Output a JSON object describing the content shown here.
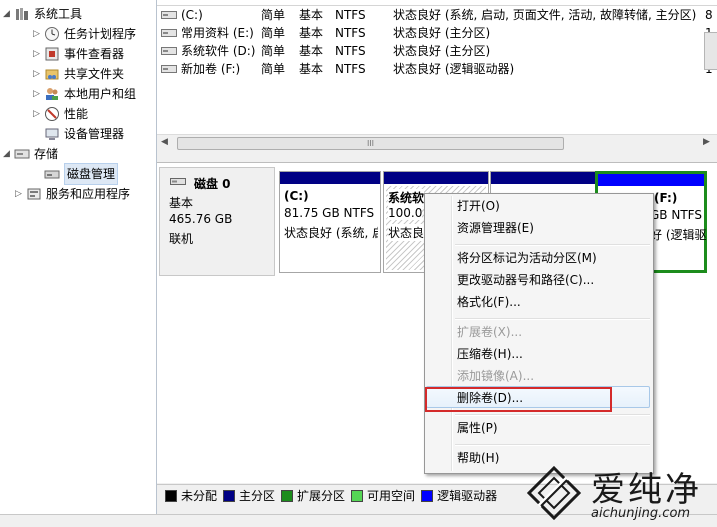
{
  "colors": {
    "primary_partition": "#000084",
    "logical_drive": "#0000ff",
    "extended_partition": "#1c8c1c",
    "free_space": "#55d655",
    "unallocated": "#000000",
    "highlight_box": "#d42a2a"
  },
  "tree": {
    "items": [
      {
        "label": "系统工具",
        "icon": "toolbox-icon",
        "expander": "expanded"
      },
      {
        "label": "任务计划程序",
        "icon": "clock-icon",
        "expander": "collapsed"
      },
      {
        "label": "事件查看器",
        "icon": "event-viewer-icon",
        "expander": "collapsed"
      },
      {
        "label": "共享文件夹",
        "icon": "shared-folder-icon",
        "expander": "collapsed"
      },
      {
        "label": "本地用户和组",
        "icon": "users-icon",
        "expander": "collapsed"
      },
      {
        "label": "性能",
        "icon": "performance-icon",
        "expander": "collapsed"
      },
      {
        "label": "设备管理器",
        "icon": "device-manager-icon",
        "expander": "none"
      },
      {
        "label": "存储",
        "icon": "storage-icon",
        "expander": "expanded"
      },
      {
        "label": "磁盘管理",
        "icon": "disk-icon",
        "expander": "none",
        "selected": true
      },
      {
        "label": "服务和应用程序",
        "icon": "services-icon",
        "expander": "collapsed"
      }
    ]
  },
  "volumes": {
    "rows": [
      {
        "name": "(C:)",
        "layout": "简单",
        "type": "基本",
        "fs": "NTFS",
        "status": "状态良好 (系统, 启动, 页面文件, 活动, 故障转储, 主分区)",
        "tail": "8"
      },
      {
        "name": "常用资料 (E:)",
        "layout": "简单",
        "type": "基本",
        "fs": "NTFS",
        "status": "状态良好 (主分区)",
        "tail": "1"
      },
      {
        "name": "系统软件 (D:)",
        "layout": "简单",
        "type": "基本",
        "fs": "NTFS",
        "status": "状态良好 (主分区)",
        "tail": "1"
      },
      {
        "name": "新加卷 (F:)",
        "layout": "简单",
        "type": "基本",
        "fs": "NTFS",
        "status": "状态良好 (逻辑驱动器)",
        "tail": "1"
      }
    ]
  },
  "scrollbar": {
    "thumb_grip": "III",
    "left_arrow": "◀",
    "right_arrow": "▶"
  },
  "disk": {
    "name": "磁盘 0",
    "type": "基本",
    "size": "465.76 GB",
    "state": "联机",
    "partitions": [
      {
        "title": "(C:)",
        "size": "81.75 GB NTFS",
        "status": "状态良好 (系统, 启"
      },
      {
        "title": "系统软",
        "size": "100.0",
        "status": "状态良"
      },
      {
        "title": "",
        "size": "",
        "status": ""
      },
      {
        "title": "(F:)",
        "size": "GB NTFS",
        "status": "好 (逻辑驱"
      }
    ]
  },
  "context_menu": {
    "open": "打开(O)",
    "explorer": "资源管理器(E)",
    "mark_active": "将分区标记为活动分区(M)",
    "change_letter": "更改驱动器号和路径(C)...",
    "format": "格式化(F)...",
    "extend": "扩展卷(X)...",
    "shrink": "压缩卷(H)...",
    "add_mirror": "添加镜像(A)...",
    "delete": "删除卷(D)...",
    "properties": "属性(P)",
    "help": "帮助(H)"
  },
  "legend": {
    "unallocated": "未分配",
    "primary": "主分区",
    "extended": "扩展分区",
    "free": "可用空间",
    "logical": "逻辑驱动器"
  },
  "watermark": {
    "title": "爱纯净",
    "url": "aichunjing.com"
  }
}
